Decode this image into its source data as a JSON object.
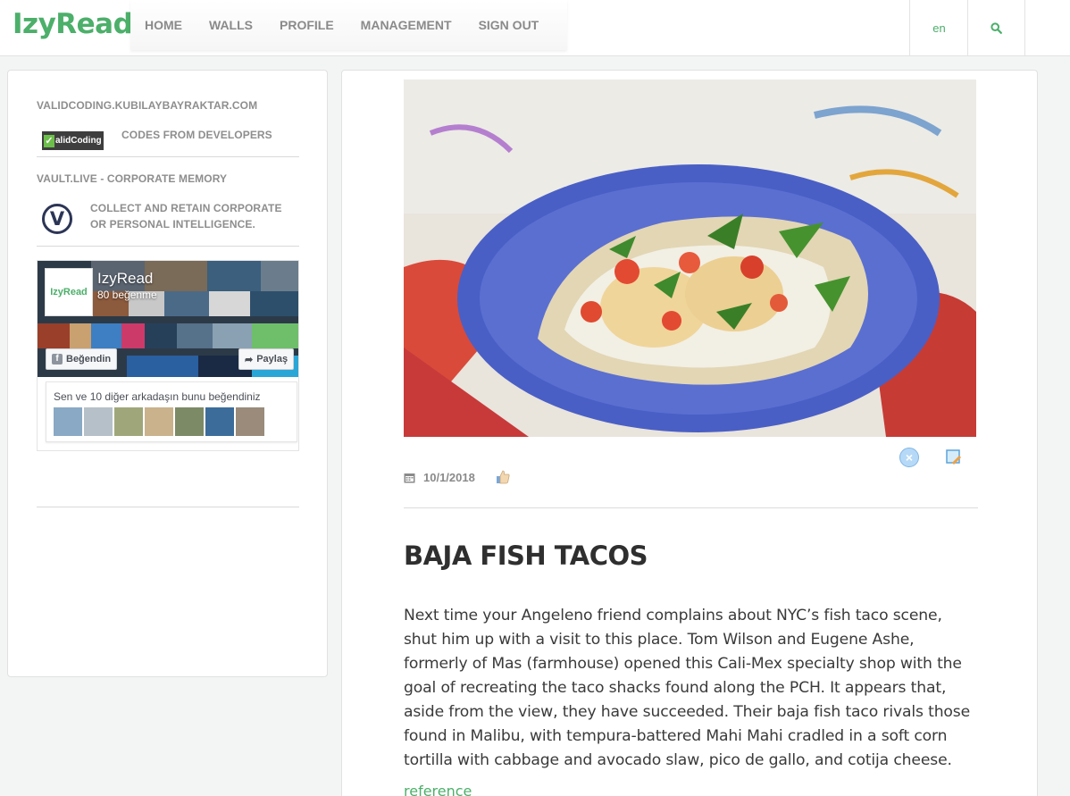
{
  "brand": {
    "logo": "IzyRead",
    "accent": "#4caf6a"
  },
  "nav": {
    "items": [
      {
        "label": "HOME"
      },
      {
        "label": "WALLS"
      },
      {
        "label": "PROFILE"
      },
      {
        "label": "MANAGEMENT"
      },
      {
        "label": "SIGN OUT"
      }
    ],
    "language": "en",
    "search_icon": "search-icon"
  },
  "sidebar": {
    "link1_title": "VALIDCODING.KUBILAYBAYRAKTAR.COM",
    "link1_logo_text": "alidCoding",
    "link1_desc": "CODES FROM DEVELOPERS",
    "link2_title": "VAULT.LIVE - CORPORATE MEMORY",
    "link2_logo_text": "V",
    "link2_desc_line1": "COLLECT AND RETAIN CORPORATE",
    "link2_desc_line2": "OR PERSONAL INTELLIGENCE.",
    "facebook": {
      "page_name": "IzyRead",
      "avatar_text": "IzyRead",
      "likes": "80 beğenme",
      "like_button": "Beğendin",
      "share_button": "Paylaş",
      "friends_text": "Sen ve 10 diğer arkadaşın bunu beğendiniz"
    }
  },
  "article": {
    "date": "10/1/2018",
    "title": "BAJA FISH TACOS",
    "body": "Next time your Angeleno friend complains about NYC’s fish taco scene, shut him up with a visit to this place. Tom Wilson and Eugene Ashe, formerly of Mas (farmhouse) opened this Cali-Mex specialty shop with the goal of recreating the taco shacks found along the PCH. It appears that, aside from the view, they have succeeded. Their baja fish taco rivals those found in Malibu, with tempura-battered Mahi Mahi cradled in a soft corn tortilla with cabbage and avocado slaw, pico de gallo, and cotija cheese.",
    "reference": "reference"
  }
}
